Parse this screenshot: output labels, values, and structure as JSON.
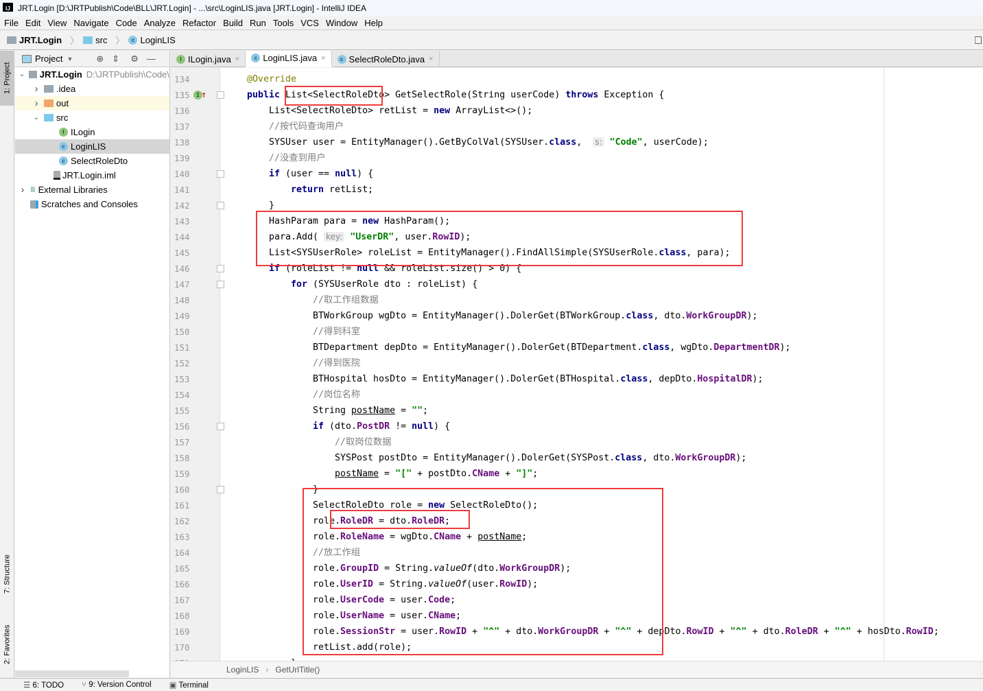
{
  "window": {
    "title": "JRT.Login [D:\\JRTPublish\\Code\\BLL\\JRT.Login] - ...\\src\\LoginLIS.java [JRT.Login] - IntelliJ IDEA"
  },
  "menu": [
    "File",
    "Edit",
    "View",
    "Navigate",
    "Code",
    "Analyze",
    "Refactor",
    "Build",
    "Run",
    "Tools",
    "VCS",
    "Window",
    "Help"
  ],
  "nav": {
    "project": "JRT.Login",
    "folder": "src",
    "file": "LoginLIS"
  },
  "tool_strip": {
    "project": "1: Project",
    "structure": "7: Structure",
    "favorites": "2: Favorites"
  },
  "project_panel": {
    "title": "Project",
    "tree": [
      {
        "label": "JRT.Login",
        "extra": "D:\\JRTPublish\\Code\\",
        "icon": "module-folder",
        "depth": 0,
        "arrow": "down",
        "bold": true
      },
      {
        "label": ".idea",
        "icon": "folder",
        "depth": 1,
        "arrow": "right"
      },
      {
        "label": "out",
        "icon": "folder-orange",
        "depth": 1,
        "arrow": "right",
        "highlight": "#fdfbe3"
      },
      {
        "label": "src",
        "icon": "folder-blue",
        "depth": 1,
        "arrow": "down"
      },
      {
        "label": "ILogin",
        "icon": "interface",
        "depth": 2
      },
      {
        "label": "LoginLIS",
        "icon": "class",
        "depth": 2,
        "selected": true
      },
      {
        "label": "SelectRoleDto",
        "icon": "class",
        "depth": 2
      },
      {
        "label": "JRT.Login.iml",
        "icon": "iml-file",
        "depth": 1
      },
      {
        "label": "External Libraries",
        "icon": "libraries",
        "depth": 0,
        "arrow": "right"
      },
      {
        "label": "Scratches and Consoles",
        "icon": "scratches",
        "depth": 0
      }
    ]
  },
  "tabs": [
    {
      "label": "ILogin.java",
      "icon": "interface"
    },
    {
      "label": "LoginLIS.java",
      "icon": "class",
      "active": true
    },
    {
      "label": "SelectRoleDto.java",
      "icon": "class"
    }
  ],
  "code": [
    {
      "n": "134",
      "i": 0,
      "t": [
        [
          "@Override",
          "ann"
        ]
      ]
    },
    {
      "n": "135",
      "i": 0,
      "t": [
        [
          "public",
          "kw"
        ],
        [
          " List<SelectRoleDto> GetSelectRole(String userCode) ",
          ""
        ],
        [
          "throws",
          "kw"
        ],
        [
          " Exception {",
          ""
        ]
      ]
    },
    {
      "n": "136",
      "i": 1,
      "t": [
        [
          "List<SelectRoleDto> retList = ",
          ""
        ],
        [
          "new",
          "kw"
        ],
        [
          " ArrayList<>();",
          ""
        ]
      ]
    },
    {
      "n": "137",
      "i": 1,
      "t": [
        [
          "//按代码查询用户",
          "cm"
        ]
      ]
    },
    {
      "n": "138",
      "i": 1,
      "t": [
        [
          "SYSUser user = EntityManager().GetByColVal(SYSUser.",
          ""
        ],
        [
          "class",
          "kw"
        ],
        [
          ",  ",
          ""
        ],
        [
          "s:",
          "hint"
        ],
        [
          " ",
          ""
        ],
        [
          "\"Code\"",
          "str"
        ],
        [
          ", userCode);",
          ""
        ]
      ]
    },
    {
      "n": "139",
      "i": 1,
      "t": [
        [
          "//没查到用户",
          "cm"
        ]
      ]
    },
    {
      "n": "140",
      "i": 1,
      "t": [
        [
          "if",
          "kw"
        ],
        [
          " (user == ",
          ""
        ],
        [
          "null",
          "kw"
        ],
        [
          ") {",
          ""
        ]
      ]
    },
    {
      "n": "141",
      "i": 2,
      "t": [
        [
          "return",
          "kw"
        ],
        [
          " retList;",
          ""
        ]
      ]
    },
    {
      "n": "142",
      "i": 1,
      "t": [
        [
          "}",
          ""
        ]
      ]
    },
    {
      "n": "143",
      "i": 1,
      "t": [
        [
          "HashParam para = ",
          ""
        ],
        [
          "new",
          "kw"
        ],
        [
          " HashParam();",
          ""
        ]
      ]
    },
    {
      "n": "144",
      "i": 1,
      "t": [
        [
          "para.Add( ",
          ""
        ],
        [
          "key:",
          "hint"
        ],
        [
          " ",
          ""
        ],
        [
          "\"UserDR\"",
          "str"
        ],
        [
          ", user.",
          ""
        ],
        [
          "RowID",
          "fld"
        ],
        [
          ");",
          ""
        ]
      ]
    },
    {
      "n": "145",
      "i": 1,
      "t": [
        [
          "List<SYSUserRole> roleList = EntityManager().FindAllSimple(SYSUserRole.",
          ""
        ],
        [
          "class",
          "kw"
        ],
        [
          ", para);",
          ""
        ]
      ]
    },
    {
      "n": "146",
      "i": 1,
      "t": [
        [
          "if",
          "kw"
        ],
        [
          " (roleList != ",
          ""
        ],
        [
          "null",
          "kw"
        ],
        [
          " && roleList.size() > 0) {",
          ""
        ]
      ]
    },
    {
      "n": "147",
      "i": 2,
      "t": [
        [
          "for",
          "kw"
        ],
        [
          " (SYSUserRole dto : roleList) {",
          ""
        ]
      ]
    },
    {
      "n": "148",
      "i": 3,
      "t": [
        [
          "//取工作组数据",
          "cm"
        ]
      ]
    },
    {
      "n": "149",
      "i": 3,
      "t": [
        [
          "BTWorkGroup wgDto = EntityManager().DolerGet(BTWorkGroup.",
          ""
        ],
        [
          "class",
          "kw"
        ],
        [
          ", dto.",
          ""
        ],
        [
          "WorkGroupDR",
          "fld"
        ],
        [
          ");",
          ""
        ]
      ]
    },
    {
      "n": "150",
      "i": 3,
      "t": [
        [
          "//得到科室",
          "cm"
        ]
      ]
    },
    {
      "n": "151",
      "i": 3,
      "t": [
        [
          "BTDepartment depDto = EntityManager().DolerGet(BTDepartment.",
          ""
        ],
        [
          "class",
          "kw"
        ],
        [
          ", wgDto.",
          ""
        ],
        [
          "DepartmentDR",
          "fld"
        ],
        [
          ");",
          ""
        ]
      ]
    },
    {
      "n": "152",
      "i": 3,
      "t": [
        [
          "//得到医院",
          "cm"
        ]
      ]
    },
    {
      "n": "153",
      "i": 3,
      "t": [
        [
          "BTHospital hosDto = EntityManager().DolerGet(BTHospital.",
          ""
        ],
        [
          "class",
          "kw"
        ],
        [
          ", depDto.",
          ""
        ],
        [
          "HospitalDR",
          "fld"
        ],
        [
          ");",
          ""
        ]
      ]
    },
    {
      "n": "154",
      "i": 3,
      "t": [
        [
          "//岗位名称",
          "cm"
        ]
      ]
    },
    {
      "n": "155",
      "i": 3,
      "t": [
        [
          "String ",
          ""
        ],
        [
          "postName",
          "ul"
        ],
        [
          " = ",
          ""
        ],
        [
          "\"\"",
          "str"
        ],
        [
          ";",
          ""
        ]
      ]
    },
    {
      "n": "156",
      "i": 3,
      "t": [
        [
          "if",
          "kw"
        ],
        [
          " (dto.",
          ""
        ],
        [
          "PostDR",
          "fld"
        ],
        [
          " != ",
          ""
        ],
        [
          "null",
          "kw"
        ],
        [
          ") {",
          ""
        ]
      ]
    },
    {
      "n": "157",
      "i": 4,
      "t": [
        [
          "//取岗位数据",
          "cm"
        ]
      ]
    },
    {
      "n": "158",
      "i": 4,
      "t": [
        [
          "SYSPost postDto = EntityManager().DolerGet(SYSPost.",
          ""
        ],
        [
          "class",
          "kw"
        ],
        [
          ", dto.",
          ""
        ],
        [
          "WorkGroupDR",
          "fld"
        ],
        [
          ");",
          ""
        ]
      ]
    },
    {
      "n": "159",
      "i": 4,
      "t": [
        [
          "postName",
          "ul"
        ],
        [
          " = ",
          ""
        ],
        [
          "\"[\"",
          "str"
        ],
        [
          " + postDto.",
          ""
        ],
        [
          "CName",
          "fld"
        ],
        [
          " + ",
          ""
        ],
        [
          "\"]\"",
          "str"
        ],
        [
          ";",
          ""
        ]
      ]
    },
    {
      "n": "160",
      "i": 3,
      "t": [
        [
          "}",
          ""
        ]
      ]
    },
    {
      "n": "161",
      "i": 3,
      "t": [
        [
          "SelectRoleDto role = ",
          ""
        ],
        [
          "new",
          "kw"
        ],
        [
          " SelectRoleDto();",
          ""
        ]
      ]
    },
    {
      "n": "162",
      "i": 3,
      "t": [
        [
          "role.",
          ""
        ],
        [
          "RoleDR",
          "fld"
        ],
        [
          " = dto.",
          ""
        ],
        [
          "RoleDR",
          "fld"
        ],
        [
          ";",
          ""
        ]
      ]
    },
    {
      "n": "163",
      "i": 3,
      "t": [
        [
          "role.",
          ""
        ],
        [
          "RoleName",
          "fld"
        ],
        [
          " = wgDto.",
          ""
        ],
        [
          "CName",
          "fld"
        ],
        [
          " + ",
          ""
        ],
        [
          "postName",
          "ul"
        ],
        [
          ";",
          ""
        ]
      ]
    },
    {
      "n": "164",
      "i": 3,
      "t": [
        [
          "//放工作组",
          "cm"
        ]
      ]
    },
    {
      "n": "165",
      "i": 3,
      "t": [
        [
          "role.",
          ""
        ],
        [
          "GroupID",
          "fld"
        ],
        [
          " = String.",
          ""
        ],
        [
          "valueOf",
          "it"
        ],
        [
          "(dto.",
          ""
        ],
        [
          "WorkGroupDR",
          "fld"
        ],
        [
          ");",
          ""
        ]
      ]
    },
    {
      "n": "166",
      "i": 3,
      "t": [
        [
          "role.",
          ""
        ],
        [
          "UserID",
          "fld"
        ],
        [
          " = String.",
          ""
        ],
        [
          "valueOf",
          "it"
        ],
        [
          "(user.",
          ""
        ],
        [
          "RowID",
          "fld"
        ],
        [
          ");",
          ""
        ]
      ]
    },
    {
      "n": "167",
      "i": 3,
      "t": [
        [
          "role.",
          ""
        ],
        [
          "UserCode",
          "fld"
        ],
        [
          " = user.",
          ""
        ],
        [
          "Code",
          "fld"
        ],
        [
          ";",
          ""
        ]
      ]
    },
    {
      "n": "168",
      "i": 3,
      "t": [
        [
          "role.",
          ""
        ],
        [
          "UserName",
          "fld"
        ],
        [
          " = user.",
          ""
        ],
        [
          "CName",
          "fld"
        ],
        [
          ";",
          ""
        ]
      ]
    },
    {
      "n": "169",
      "i": 3,
      "t": [
        [
          "role.",
          ""
        ],
        [
          "SessionStr",
          "fld"
        ],
        [
          " = user.",
          ""
        ],
        [
          "RowID",
          "fld"
        ],
        [
          " + ",
          ""
        ],
        [
          "\"^\"",
          "str"
        ],
        [
          " + dto.",
          ""
        ],
        [
          "WorkGroupDR",
          "fld"
        ],
        [
          " + ",
          ""
        ],
        [
          "\"^\"",
          "str"
        ],
        [
          " + depDto.",
          ""
        ],
        [
          "RowID",
          "fld"
        ],
        [
          " + ",
          ""
        ],
        [
          "\"^\"",
          "str"
        ],
        [
          " + dto.",
          ""
        ],
        [
          "RoleDR",
          "fld"
        ],
        [
          " + ",
          ""
        ],
        [
          "\"^\"",
          "str"
        ],
        [
          " + hosDto.",
          ""
        ],
        [
          "RowID",
          "fld"
        ],
        [
          ";",
          ""
        ]
      ]
    },
    {
      "n": "170",
      "i": 3,
      "t": [
        [
          "retList.add(role);",
          ""
        ]
      ]
    },
    {
      "n": "171",
      "i": 2,
      "t": [
        [
          "}",
          ""
        ]
      ]
    }
  ],
  "editor_breadcrumb": {
    "class": "LoginLIS",
    "method": "GetUrlTitle()"
  },
  "status_bar": [
    {
      "label": "6: TODO",
      "icon": "todo-list-icon"
    },
    {
      "label": "9: Version Control",
      "icon": "version-control-icon"
    },
    {
      "label": "Terminal",
      "icon": "terminal-icon"
    }
  ],
  "colors": {
    "annotation_box": "#f03a3a",
    "keyword": "#000080",
    "string": "#008000",
    "field": "#660e7a",
    "comment": "#808080"
  }
}
